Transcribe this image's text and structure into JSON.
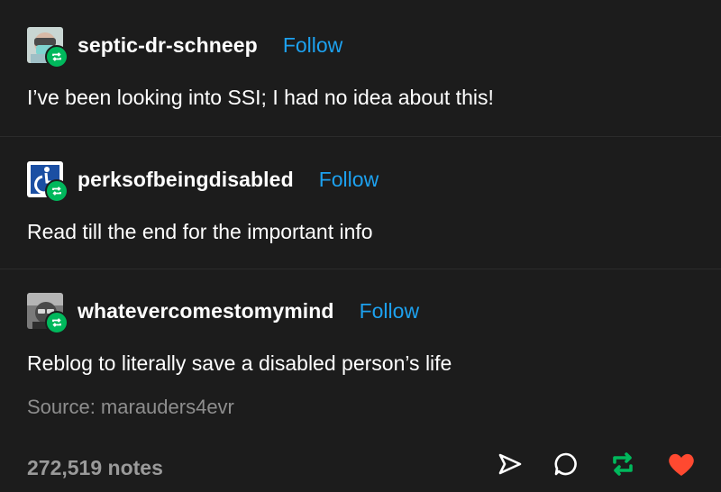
{
  "posts": [
    {
      "username": "septic-dr-schneep",
      "follow_label": "Follow",
      "body": "I’ve been looking into SSI; I had no idea about this!"
    },
    {
      "username": "perksofbeingdisabled",
      "follow_label": "Follow",
      "body": "Read till the end for the important info"
    },
    {
      "username": "whatevercomestomymind",
      "follow_label": "Follow",
      "body": "Reblog to literally save a disabled person’s life",
      "source": "Source: marauders4evr"
    }
  ],
  "footer": {
    "notes": "272,519 notes",
    "icons": [
      "share-icon",
      "reply-icon",
      "reblog-icon",
      "like-icon"
    ]
  },
  "colors": {
    "background": "#1c1c1c",
    "follow": "#1da1ef",
    "reblog": "#00b85c",
    "like": "#ff4930"
  }
}
